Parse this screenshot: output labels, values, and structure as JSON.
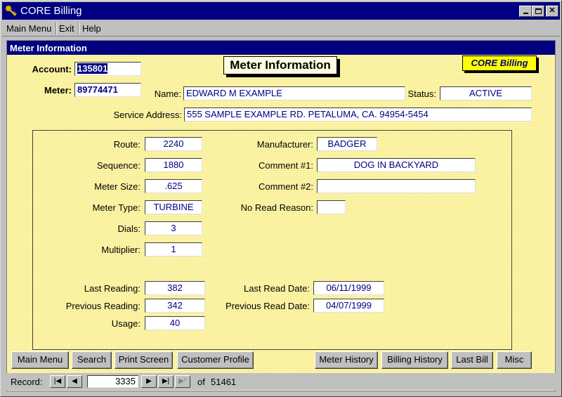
{
  "window": {
    "title": "CORE Billing",
    "icon": "key-icon",
    "controls": [
      "minimize",
      "maximize",
      "close"
    ]
  },
  "menu": {
    "items": [
      "Main Menu",
      "Exit",
      "Help"
    ]
  },
  "form": {
    "header": "Meter Information",
    "heading": "Meter Information",
    "badge": "CORE Billing",
    "account_label": "Account:",
    "account_value": "135801",
    "meter_label": "Meter:",
    "meter_value": "89774471",
    "name_label": "Name:",
    "name_value": "EDWARD M EXAMPLE",
    "status_label": "Status:",
    "status_value": "ACTIVE",
    "service_label": "Service Address:",
    "service_value": "555 SAMPLE EXAMPLE RD. PETALUMA, CA. 94954-5454",
    "route_label": "Route:",
    "route_value": "2240",
    "sequence_label": "Sequence:",
    "sequence_value": "1880",
    "metersize_label": "Meter Size:",
    "metersize_value": ".625",
    "metertype_label": "Meter Type:",
    "metertype_value": "TURBINE",
    "dials_label": "Dials:",
    "dials_value": "3",
    "multiplier_label": "Multiplier:",
    "multiplier_value": "1",
    "manufacturer_label": "Manufacturer:",
    "manufacturer_value": "BADGER",
    "comment1_label": "Comment #1:",
    "comment1_value": "DOG IN BACKYARD",
    "comment2_label": "Comment #2:",
    "comment2_value": "",
    "noread_label": "No Read Reason:",
    "noread_value": "",
    "lastreading_label": "Last Reading:",
    "lastreading_value": "382",
    "prevreading_label": "Previous Reading:",
    "prevreading_value": "342",
    "usage_label": "Usage:",
    "usage_value": "40",
    "lastreaddate_label": "Last Read Date:",
    "lastreaddate_value": "06/11/1999",
    "prevreaddate_label": "Previous Read Date:",
    "prevreaddate_value": "04/07/1999"
  },
  "buttons": {
    "main_menu": "Main Menu",
    "search": "Search",
    "print_screen": "Print Screen",
    "customer_profile": "Customer Profile",
    "meter_history": "Meter History",
    "billing_history": "Billing History",
    "last_bill": "Last Bill",
    "misc": "Misc"
  },
  "navigation": {
    "record_label": "Record:",
    "current_record": "3335",
    "of_label": "of",
    "total_records": "51461"
  },
  "colors": {
    "title_bar": "#000080",
    "form_background": "#fdf5a6",
    "field_text": "#000080",
    "badge_background": "#ffff00"
  }
}
